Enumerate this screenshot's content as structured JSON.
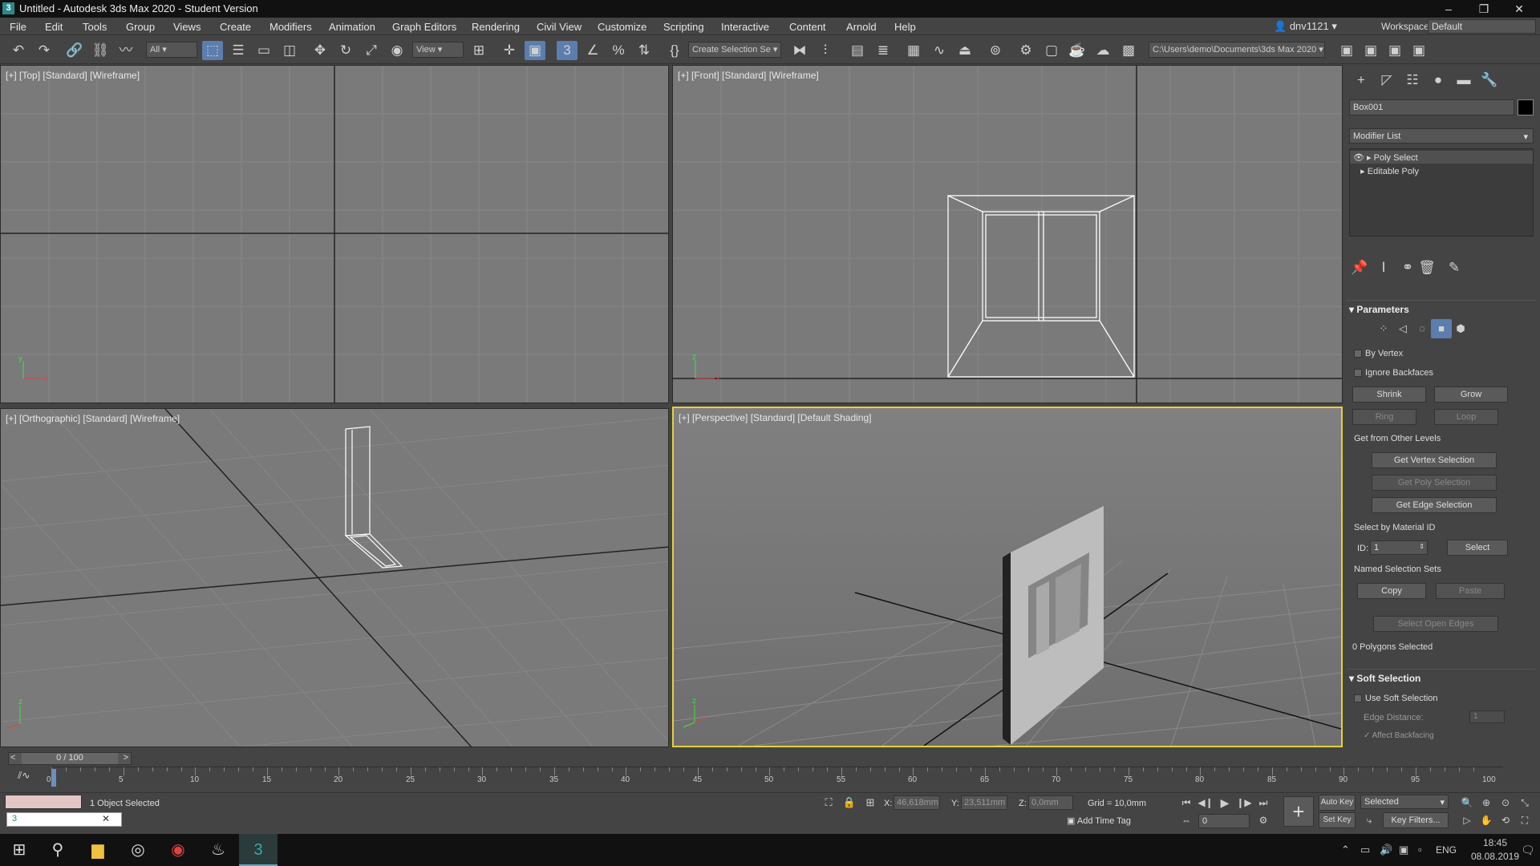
{
  "window": {
    "title": "Untitled - Autodesk 3ds Max 2020 - Student Version",
    "app_icon": "3"
  },
  "menu": [
    "File",
    "Edit",
    "Tools",
    "Group",
    "Views",
    "Create",
    "Modifiers",
    "Animation",
    "Graph Editors",
    "Rendering",
    "Civil View",
    "Customize",
    "Scripting",
    "Interactive",
    "Content",
    "Arnold",
    "Help"
  ],
  "account": {
    "user": "dnv1121",
    "workspaces_label": "Workspaces:",
    "workspace": "Default"
  },
  "toolbar": {
    "filter": "All",
    "ref_coord": "View",
    "selection_set": "Create Selection Se",
    "project_path": "C:\\Users\\demo\\Documents\\3ds Max 2020"
  },
  "viewports": {
    "top": "[+] [Top] [Standard] [Wireframe]",
    "front": "[+] [Front] [Standard] [Wireframe]",
    "ortho": "[+] [Orthographic] [Standard] [Wireframe]",
    "persp": "[+] [Perspective] [Standard] [Default Shading]"
  },
  "panel": {
    "object_name": "Box001",
    "modifier_list": "Modifier List",
    "stack": [
      "Poly Select",
      "Editable Poly"
    ],
    "params_title": "Parameters",
    "by_vertex": "By Vertex",
    "ignore_backfaces": "Ignore Backfaces",
    "shrink": "Shrink",
    "grow": "Grow",
    "ring": "Ring",
    "loop": "Loop",
    "get_from": "Get from Other Levels",
    "get_vertex": "Get Vertex Selection",
    "get_poly": "Get Poly Selection",
    "get_edge": "Get Edge Selection",
    "select_by_mat": "Select by Material ID",
    "id_label": "ID:",
    "id_value": "1",
    "select": "Select",
    "named_sets": "Named Selection Sets",
    "copy": "Copy",
    "paste": "Paste",
    "open_edges": "Select Open Edges",
    "poly_selected": "0 Polygons Selected",
    "soft_title": "Soft Selection",
    "use_soft": "Use Soft Selection",
    "edge_distance": "Edge Distance:",
    "edge_distance_value": "1",
    "affect_backfacing": "Affect Backfacing"
  },
  "timeline": {
    "frame": "0 / 100",
    "ticks": [
      "0",
      "5",
      "10",
      "15",
      "20",
      "25",
      "30",
      "35",
      "40",
      "45",
      "50",
      "55",
      "60",
      "65",
      "70",
      "75",
      "80",
      "85",
      "90",
      "95",
      "100"
    ]
  },
  "status": {
    "selected": "1 Object Selected",
    "x_label": "X:",
    "x": "46,618mm",
    "y_label": "Y:",
    "y": "23,511mm",
    "z_label": "Z:",
    "z": "0,0mm",
    "grid": "Grid = 10,0mm",
    "add_time_tag": "Add Time Tag",
    "auto_key": "Auto Key",
    "set_key": "Set Key",
    "key_mode": "Selected",
    "key_filters": "Key Filters...",
    "frame_field": "0"
  },
  "taskbar": {
    "lang": "ENG",
    "time": "18:45",
    "date": "08.08.2019"
  }
}
